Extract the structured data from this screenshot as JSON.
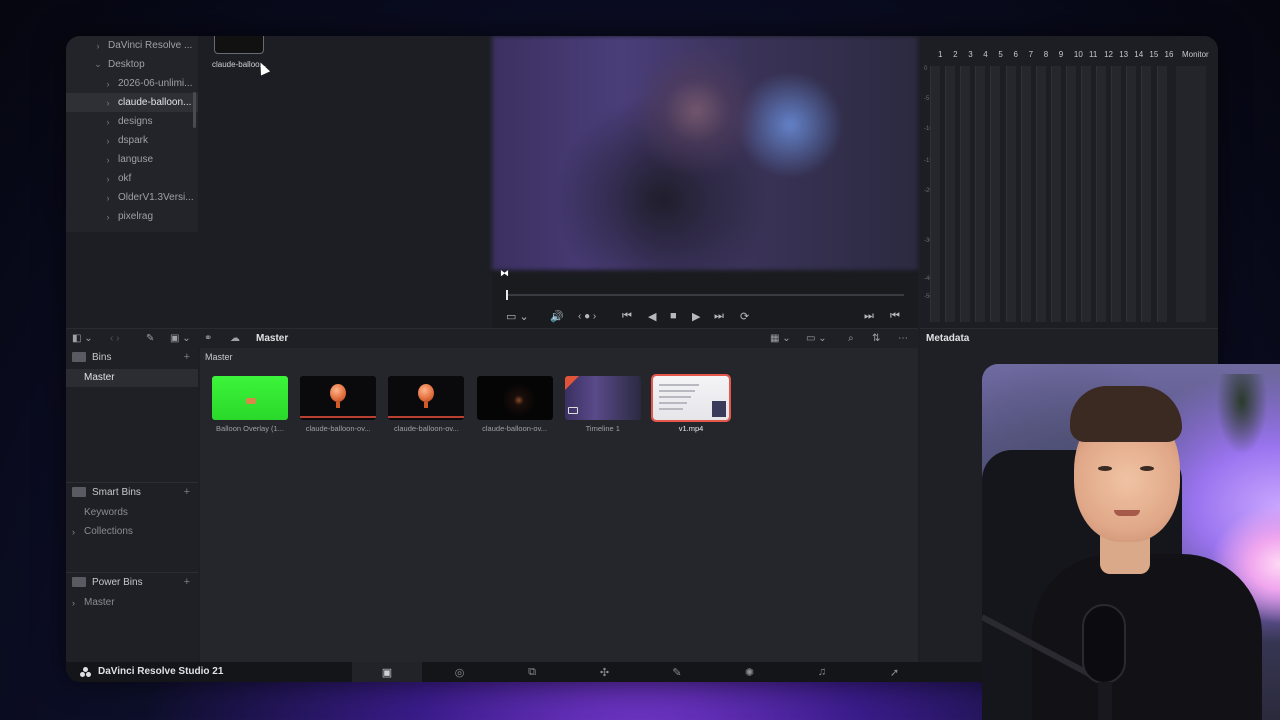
{
  "media_storage": {
    "tree_items": [
      {
        "label": "DaVinci Resolve ...",
        "chevron": "›",
        "selected": false
      },
      {
        "label": "Desktop",
        "chevron": "⌄",
        "selected": false
      },
      {
        "label": "2026-06-unlimi...",
        "chevron": "›",
        "selected": false
      },
      {
        "label": "claude-balloon...",
        "chevron": "›",
        "selected": true
      },
      {
        "label": "designs",
        "chevron": "›",
        "selected": false
      },
      {
        "label": "dspark",
        "chevron": "›",
        "selected": false
      },
      {
        "label": "languse",
        "chevron": "›",
        "selected": false
      },
      {
        "label": "okf",
        "chevron": "›",
        "selected": false
      },
      {
        "label": "OlderV1.3Versi...",
        "chevron": "›",
        "selected": false
      },
      {
        "label": "pixelrag",
        "chevron": "›",
        "selected": false
      }
    ],
    "file_label": "claude-balloo..."
  },
  "viewer": {
    "mark_glyph": "⧓",
    "transport": {
      "prev_clip": "⏮",
      "step_back": "◀",
      "stop": "■",
      "play": "▶",
      "next_clip": "⏭",
      "loop": "⟳",
      "volume": "🔊",
      "jog": "‹ ● ›",
      "mark_in": "⏭",
      "mark_out": "⏮"
    },
    "playhead_fraction": 0.0
  },
  "audio_meters": {
    "channels": [
      "1",
      "2",
      "3",
      "4",
      "5",
      "6",
      "7",
      "8",
      "9",
      "10",
      "11",
      "12",
      "13",
      "14",
      "15",
      "16"
    ],
    "monitor_label": "Monitor",
    "db_scale": [
      "0",
      "-5",
      "-10",
      "-15",
      "-20",
      "-30",
      "-40",
      "-50"
    ]
  },
  "toolbar": {
    "title": "Master",
    "sort_icon": "⇅",
    "more_icon": "⋯"
  },
  "metadata": {
    "title": "Metadata"
  },
  "bins": {
    "bins_label": "Bins",
    "master_label": "Master",
    "smart_bins_label": "Smart Bins",
    "keywords_label": "Keywords",
    "collections_label": "Collections",
    "power_bins_label": "Power Bins",
    "power_master_label": "Master",
    "plus": "+"
  },
  "media_pool": {
    "breadcrumb": "Master",
    "clips": [
      {
        "name": "Balloon Overlay (1...",
        "kind": "green"
      },
      {
        "name": "claude-balloon-ov...",
        "kind": "balloon"
      },
      {
        "name": "claude-balloon-ov...",
        "kind": "balloon"
      },
      {
        "name": "claude-balloon-ov...",
        "kind": "particles"
      },
      {
        "name": "Timeline 1",
        "kind": "timeline"
      },
      {
        "name": "v1.mp4",
        "kind": "screen",
        "selected": true
      }
    ]
  },
  "pagebar": {
    "brand": "DaVinci Resolve Studio 21",
    "pages": [
      {
        "name": "media",
        "glyph": "▣",
        "active": true
      },
      {
        "name": "cut",
        "glyph": "◎"
      },
      {
        "name": "edit",
        "glyph": "⧉"
      },
      {
        "name": "fusion",
        "glyph": "✣"
      },
      {
        "name": "color",
        "glyph": "✎"
      },
      {
        "name": "fairlight-effects",
        "glyph": "✺"
      },
      {
        "name": "fairlight",
        "glyph": "♫"
      },
      {
        "name": "deliver",
        "glyph": "➚"
      }
    ]
  }
}
